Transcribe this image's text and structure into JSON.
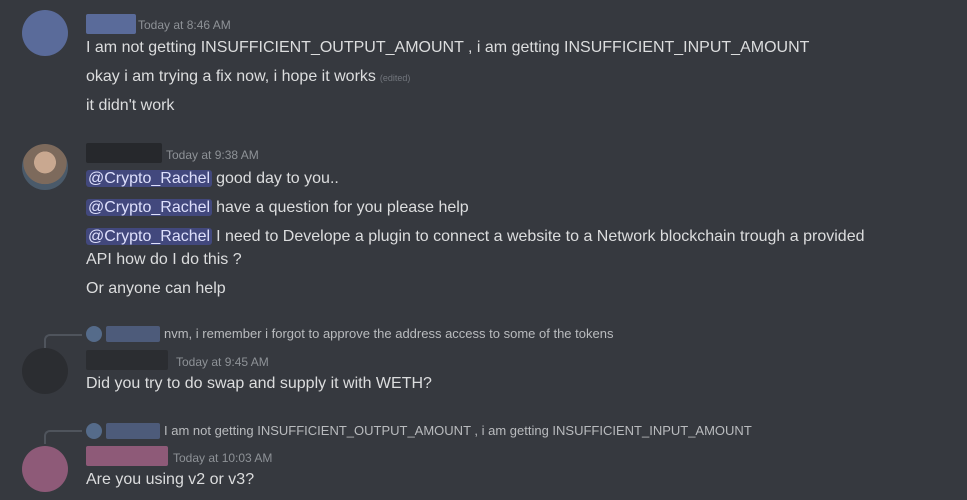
{
  "messages": [
    {
      "timestamp": "Today at 8:46 AM",
      "lines": [
        "I am not getting INSUFFICIENT_OUTPUT_AMOUNT , i am getting INSUFFICIENT_INPUT_AMOUNT",
        "okay i am trying a fix now, i hope it works",
        "it didn't work"
      ],
      "edited_label": "(edited)"
    },
    {
      "timestamp": "Today at 9:38 AM",
      "mention": "@Crypto_Rachel",
      "lines": [
        "good day to you..",
        "have a question for you please help",
        "I need to Develope a plugin to connect a website to a Network blockchain trough a provided",
        "API how do I do this ?",
        "Or anyone can help"
      ]
    },
    {
      "reply_text": "nvm, i remember i forgot to approve the address access to some of the tokens",
      "timestamp": "Today at 9:45 AM",
      "lines": [
        "Did you try to do swap and supply it with WETH?"
      ]
    },
    {
      "reply_text": "I am not getting INSUFFICIENT_OUTPUT_AMOUNT , i am getting INSUFFICIENT_INPUT_AMOUNT",
      "timestamp": "Today at 10:03 AM",
      "lines": [
        "Are you using v2 or v3?"
      ]
    }
  ],
  "colors": {
    "background": "#36393f",
    "mention_bg": "#4c5694",
    "avatar1": "#5a6b9a",
    "avatar3": "#2b2d31",
    "avatar4": "#8e5a78"
  }
}
